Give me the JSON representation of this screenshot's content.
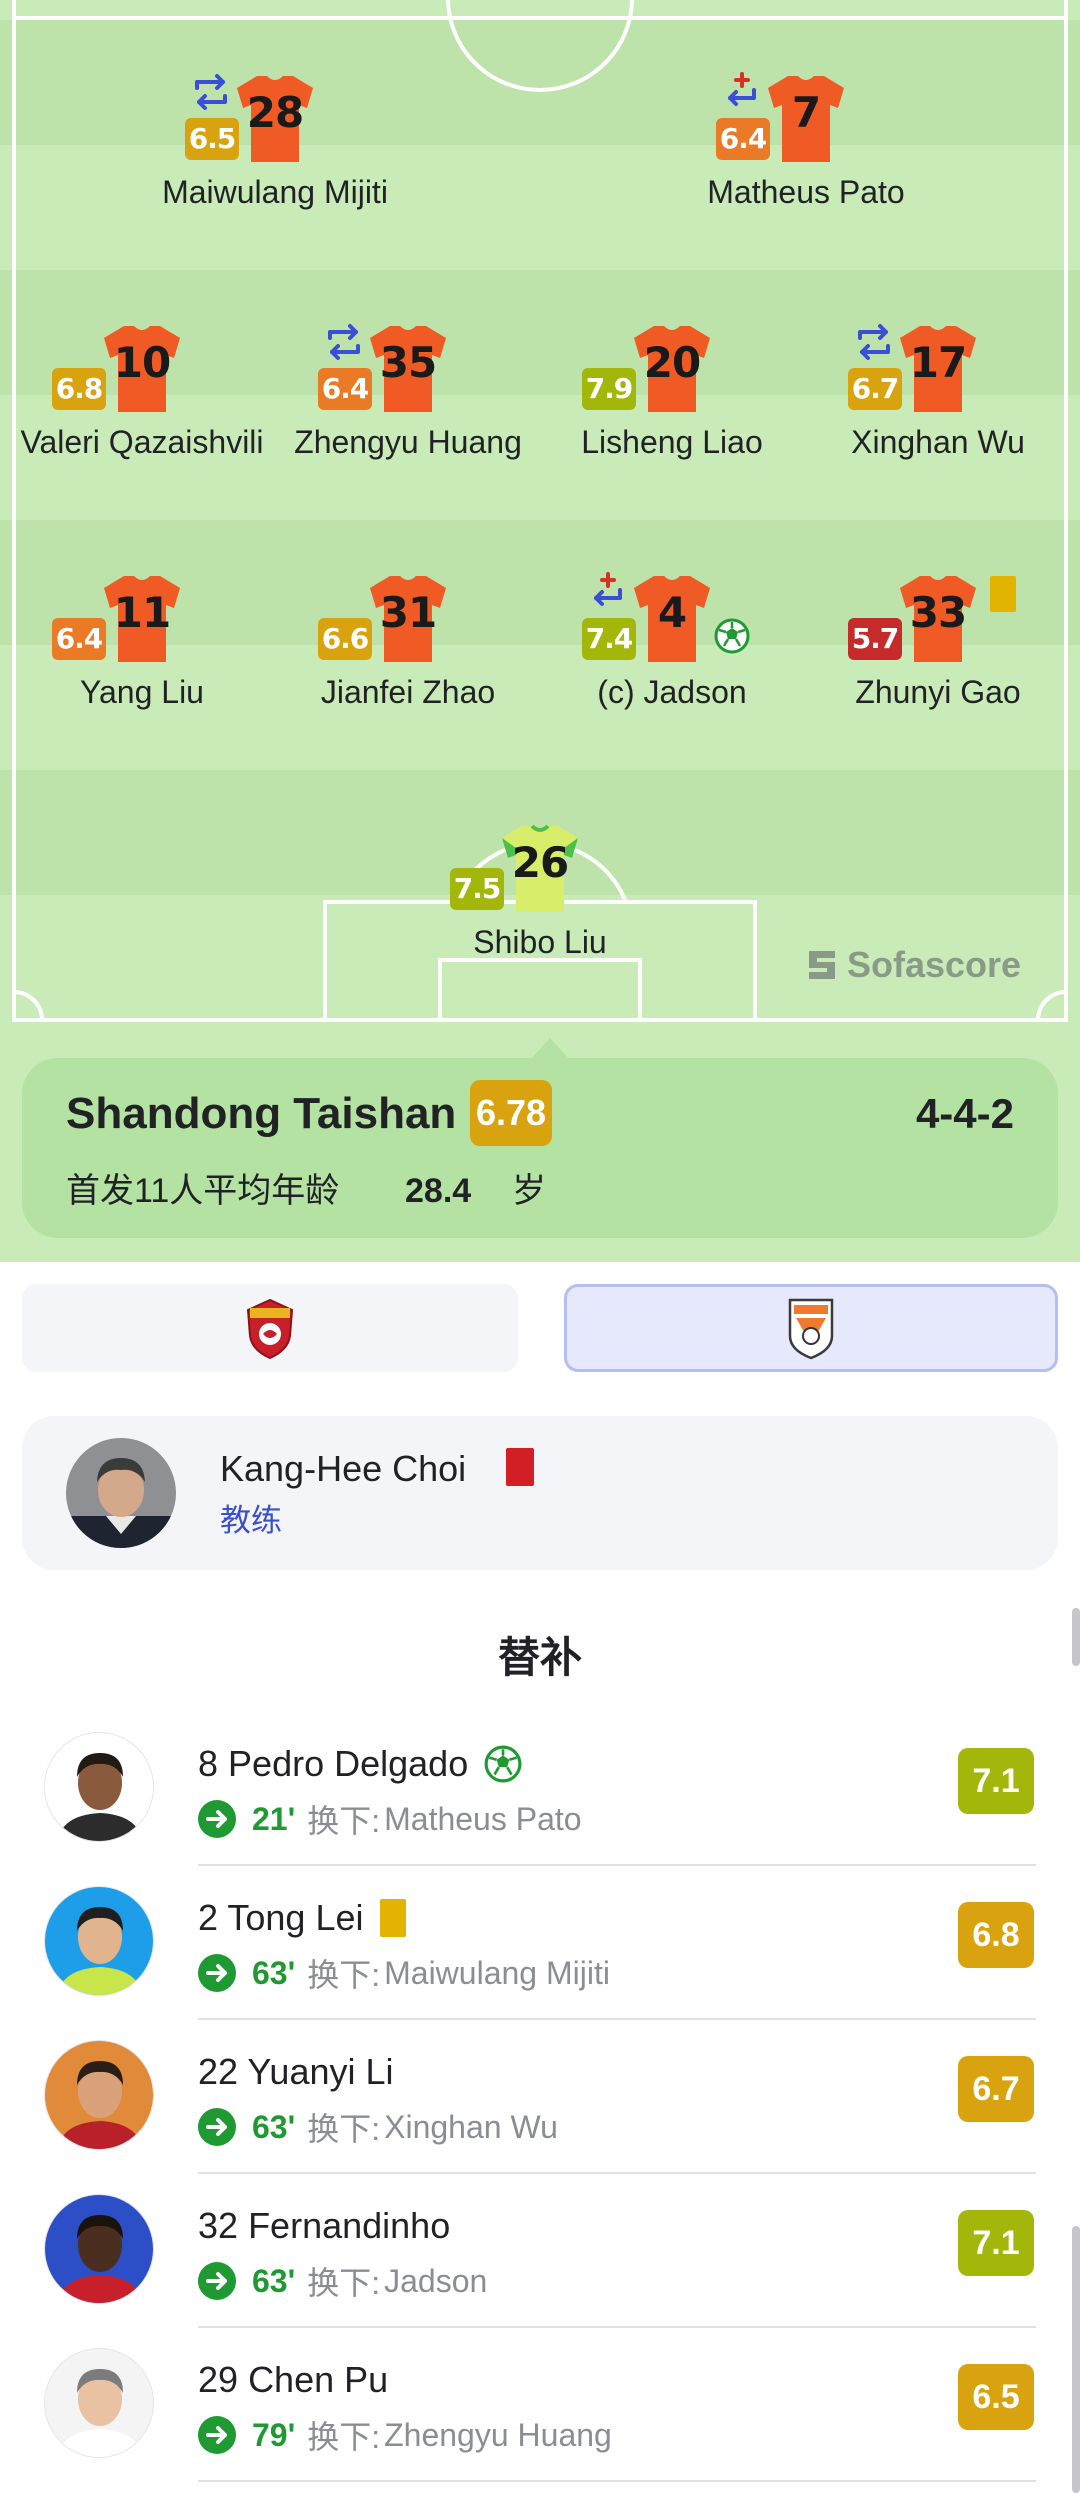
{
  "colors": {
    "pitch": "#c8ebb8",
    "pitch_stripe": "#bde3aa",
    "shirt": "#f05a24",
    "goalkeeper_shirt": "#d8ee6a",
    "rating_orange": "#ea7a25",
    "rating_yellow": "#d8a30f",
    "rating_green": "#a3b70a",
    "rating_red": "#c62b2b",
    "sub_green": "#1f9a32",
    "coach_role": "#3a4fd0"
  },
  "lineup": {
    "players": [
      {
        "number": "28",
        "name": "Maiwulang Mijiti",
        "rating": "6.5",
        "rating_color": "#d8a30f",
        "subbed": "swap"
      },
      {
        "number": "7",
        "name": "Matheus Pato",
        "rating": "6.4",
        "rating_color": "#ea7a25",
        "subbed": "injury"
      },
      {
        "number": "10",
        "name": "Valeri Qazaishvili",
        "rating": "6.8",
        "rating_color": "#d8a30f"
      },
      {
        "number": "35",
        "name": "Zhengyu Huang",
        "rating": "6.4",
        "rating_color": "#ea7a25",
        "subbed": "swap"
      },
      {
        "number": "20",
        "name": "Lisheng Liao",
        "rating": "7.9",
        "rating_color": "#a3b70a"
      },
      {
        "number": "17",
        "name": "Xinghan Wu",
        "rating": "6.7",
        "rating_color": "#d8a30f",
        "subbed": "swap"
      },
      {
        "number": "11",
        "name": "Yang Liu",
        "rating": "6.4",
        "rating_color": "#ea7a25"
      },
      {
        "number": "31",
        "name": "Jianfei Zhao",
        "rating": "6.6",
        "rating_color": "#d8a30f"
      },
      {
        "number": "4",
        "name": "(c) Jadson",
        "rating": "7.4",
        "rating_color": "#a3b70a",
        "subbed": "injury",
        "goal": true
      },
      {
        "number": "33",
        "name": "Zhunyi Gao",
        "rating": "5.7",
        "rating_color": "#c62b2b",
        "yellow_card": true
      },
      {
        "number": "26",
        "name": "Shibo Liu",
        "rating": "7.5",
        "rating_color": "#a3b70a",
        "goalkeeper": true
      }
    ]
  },
  "watermark": "Sofascore",
  "team": {
    "name": "Shandong Taishan",
    "rating": "6.78",
    "formation": "4-4-2",
    "avg_age_label": "首发11人平均年龄",
    "avg_age_value": "28.4",
    "avg_age_unit": "岁"
  },
  "team_toggle": {
    "home_icon": "shanghai-port-crest-icon",
    "away_icon": "shandong-taishan-crest-icon",
    "selected": "away"
  },
  "coach": {
    "name": "Kang-Hee Choi",
    "role": "教练",
    "red_card": true
  },
  "substitutes_title": "替补",
  "substitutes": [
    {
      "number": "8",
      "name": "Pedro Delgado",
      "minute": "21'",
      "off_label": "换下:",
      "off_player": "Matheus Pato",
      "rating": "7.1",
      "rating_color": "#a3b70a",
      "goal": true
    },
    {
      "number": "2",
      "name": "Tong Lei",
      "minute": "63'",
      "off_label": "换下:",
      "off_player": "Maiwulang Mijiti",
      "rating": "6.8",
      "rating_color": "#d8a30f",
      "yellow_card": true
    },
    {
      "number": "22",
      "name": "Yuanyi Li",
      "minute": "63'",
      "off_label": "换下:",
      "off_player": "Xinghan Wu",
      "rating": "6.7",
      "rating_color": "#d8a30f"
    },
    {
      "number": "32",
      "name": "Fernandinho",
      "minute": "63'",
      "off_label": "换下:",
      "off_player": "Jadson",
      "rating": "7.1",
      "rating_color": "#a3b70a"
    },
    {
      "number": "29",
      "name": "Chen Pu",
      "minute": "79'",
      "off_label": "换下:",
      "off_player": "Zhengyu Huang",
      "rating": "6.5",
      "rating_color": "#d8a30f"
    }
  ]
}
